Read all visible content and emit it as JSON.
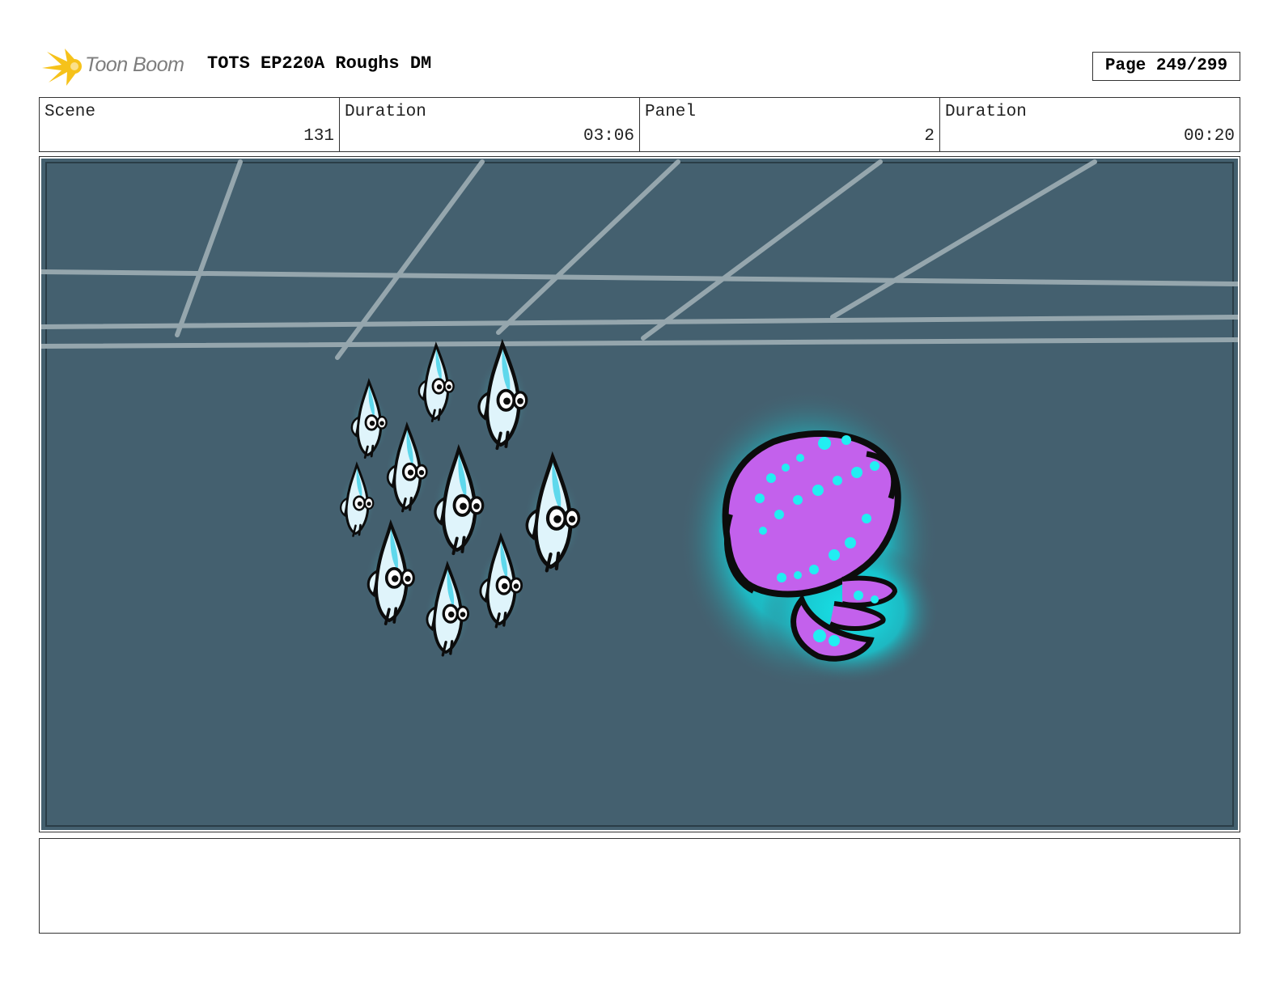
{
  "header": {
    "brand": "Toon Boom",
    "title": "TOTS EP220A Roughs DM",
    "page": "Page 249/299"
  },
  "info": {
    "scene_label": "Scene",
    "scene_value": "131",
    "scene_duration_label": "Duration",
    "scene_duration_value": "03:06",
    "panel_label": "Panel",
    "panel_value": "2",
    "panel_duration_label": "Duration",
    "panel_duration_value": "00:20"
  },
  "panel": {
    "background_color": "#44606f",
    "glow_color": "#17e6ea",
    "creature_color": "#c361ec"
  },
  "notes": {
    "text": ""
  }
}
